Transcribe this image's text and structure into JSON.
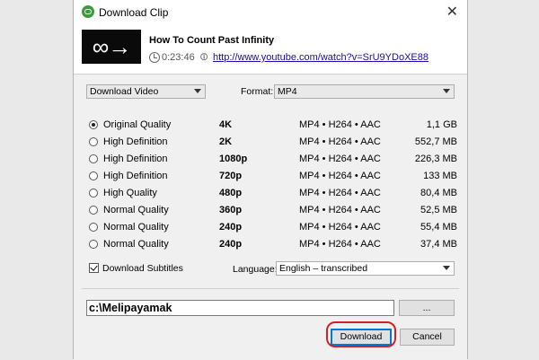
{
  "window": {
    "title": "Download Clip",
    "close_glyph": "✕"
  },
  "video": {
    "thumbnail_glyph": "∞→",
    "title": "How To Count Past Infinity",
    "duration": "0:23:46",
    "url": "http://www.youtube.com/watch?v=SrU9YDoXE88"
  },
  "download_type": {
    "selected": "Download Video"
  },
  "format": {
    "label": "Format:",
    "selected": "MP4"
  },
  "qualities": [
    {
      "name": "Original Quality",
      "resolution": "4K",
      "format": "MP4 • H264 • AAC",
      "size": "1,1 GB",
      "checked": true
    },
    {
      "name": "High Definition",
      "resolution": "2K",
      "format": "MP4 • H264 • AAC",
      "size": "552,7 MB",
      "checked": false
    },
    {
      "name": "High Definition",
      "resolution": "1080p",
      "format": "MP4 • H264 • AAC",
      "size": "226,3 MB",
      "checked": false
    },
    {
      "name": "High Definition",
      "resolution": "720p",
      "format": "MP4 • H264 • AAC",
      "size": "133 MB",
      "checked": false
    },
    {
      "name": "High Quality",
      "resolution": "480p",
      "format": "MP4 • H264 • AAC",
      "size": "80,4 MB",
      "checked": false
    },
    {
      "name": "Normal Quality",
      "resolution": "360p",
      "format": "MP4 • H264 • AAC",
      "size": "52,5 MB",
      "checked": false
    },
    {
      "name": "Normal Quality",
      "resolution": "240p",
      "format": "MP4 • H264 • AAC",
      "size": "55,4 MB",
      "checked": false
    },
    {
      "name": "Normal Quality",
      "resolution": "240p",
      "format": "MP4 • H264 • AAC",
      "size": "37,4 MB",
      "checked": false
    }
  ],
  "subtitles": {
    "label": "Download Subtitles",
    "checked": true
  },
  "language": {
    "label": "Language:",
    "selected": "English – transcribed"
  },
  "save_path": {
    "value": "c:\\Melipayamak"
  },
  "buttons": {
    "browse": "...",
    "download": "Download",
    "cancel": "Cancel"
  },
  "colors": {
    "app_icon": "#3e9a3e",
    "link": "#1a0dab",
    "highlight": "#d32020",
    "focus": "#0078d7"
  }
}
